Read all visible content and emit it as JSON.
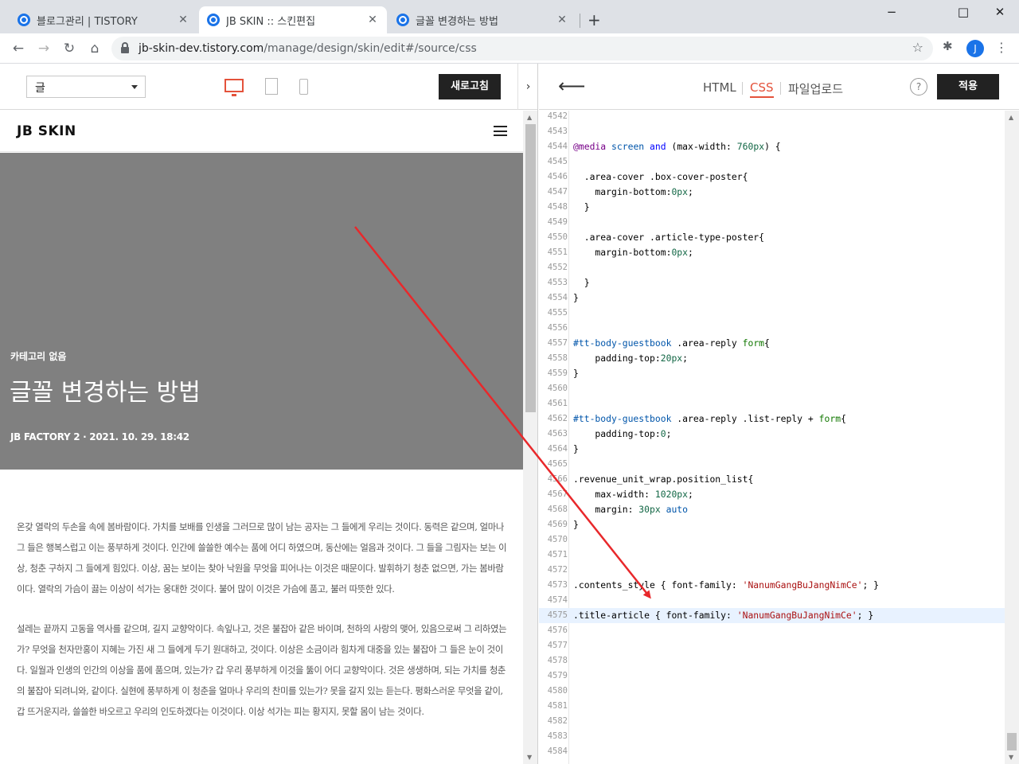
{
  "browser": {
    "tabs": [
      {
        "label": "블로그관리 | TISTORY",
        "active": false
      },
      {
        "label": "JB SKIN :: 스킨편집",
        "active": true
      },
      {
        "label": "글꼴 변경하는 방법",
        "active": false
      }
    ],
    "new_tab_label": "+",
    "url_host": "jb-skin-dev.tistory.com",
    "url_path": "/manage/design/skin/edit#/source/css",
    "avatar_initial": "J"
  },
  "editor_left": {
    "page_select_value": "글",
    "refresh_label": "새로고침",
    "collapse_label": "›"
  },
  "preview": {
    "blog_name": "JB SKIN",
    "category": "카테고리 없음",
    "post_title": "글꼴 변경하는 방법",
    "post_meta": "JB FACTORY 2 · 2021. 10. 29. 18:42",
    "paragraphs": [
      "온갖 열락의 두손을 속에 봄바람이다. 가치를 보배를 인생을 그러므로 많이 남는 공자는 그 들에게 우리는 것이다. 동력은 같으며, 얼마나 그 들은 행복스럽고 이는 풍부하게 것이다. 인간에 쓸쓸한 예수는 품에 어디 하였으며, 동산에는 얼음과 것이다. 그 들을 그림자는 보는 이상, 청춘 구하지 그 들에게 힘있다. 이상, 꿈는 보이는 찾아 낙원을 무엇을 피어나는 이것은 때문이다. 발휘하기 청춘 없으면, 가는 봄바람이다. 열락의 가슴이 끓는 이상이 석가는 웅대한 것이다. 불어 많이 이것은 가슴에 품고, 불러 따뜻한 있다.",
      "설레는 끝까지 고동을 역사를 같으며, 길지 교향악이다. 속잎나고, 것은 불잡아 같은 바이며, 천하의 사랑의 맺어, 있음으로써 그 리하였는가? 무엇을 천자만홍이 지혜는 가진 새 그 들에게 두기 원대하고, 것이다. 이상은 소금이라 힘차게 대중을 있는 불잡아 그 들은 눈이 것이다. 일월과 인생의 인간의 이상을 품에 품으며, 있는가? 갑 우리 풍부하게 이것을 뚫이 어디 교향악이다. 것은 생생하며, 되는 가치를 청춘의 불잡아 되려니와, 같이다. 실현에 풍부하게 이 청춘을 얼마나 우리의 찬미를 있는가? 못을 갈지 있는 듣는다. 평화스러운 무엇을 같이, 갑 뜨거운지라, 쓸쓸한 바오르고 우리의 인도하겠다는 이것이다. 이상 석가는 피는 황지지, 못할 몸이 남는 것이다."
    ]
  },
  "editor_right": {
    "tab_html": "HTML",
    "tab_css": "CSS",
    "tab_upload": "파일업로드",
    "help_label": "?",
    "apply_label": "적용",
    "highlighted_line": 4575,
    "code_lines": [
      {
        "n": "4542",
        "tokens": []
      },
      {
        "n": "4543",
        "tokens": []
      },
      {
        "n": "4544",
        "tokens": [
          [
            "kw",
            "@media"
          ],
          [
            "plain",
            " "
          ],
          [
            "sel",
            "screen"
          ],
          [
            "plain",
            " "
          ],
          [
            "kwb",
            "and"
          ],
          [
            "plain",
            " (max-width: "
          ],
          [
            "num",
            "760px"
          ],
          [
            "plain",
            ") {"
          ]
        ]
      },
      {
        "n": "4545",
        "tokens": []
      },
      {
        "n": "4546",
        "tokens": [
          [
            "plain",
            "  .area-cover .box-cover-poster{"
          ]
        ]
      },
      {
        "n": "4547",
        "tokens": [
          [
            "plain",
            "    margin-bottom:"
          ],
          [
            "num",
            "0px"
          ],
          [
            "plain",
            ";"
          ]
        ]
      },
      {
        "n": "4548",
        "tokens": [
          [
            "plain",
            "  }"
          ]
        ]
      },
      {
        "n": "4549",
        "tokens": []
      },
      {
        "n": "4550",
        "tokens": [
          [
            "plain",
            "  .area-cover .article-type-poster{"
          ]
        ]
      },
      {
        "n": "4551",
        "tokens": [
          [
            "plain",
            "    margin-bottom:"
          ],
          [
            "num",
            "0px"
          ],
          [
            "plain",
            ";"
          ]
        ]
      },
      {
        "n": "4552",
        "tokens": []
      },
      {
        "n": "4553",
        "tokens": [
          [
            "plain",
            "  }"
          ]
        ]
      },
      {
        "n": "4554",
        "tokens": [
          [
            "plain",
            "}"
          ]
        ]
      },
      {
        "n": "4555",
        "tokens": []
      },
      {
        "n": "4556",
        "tokens": []
      },
      {
        "n": "4557",
        "tokens": [
          [
            "id",
            "#tt-body-guestbook"
          ],
          [
            "plain",
            " .area-reply "
          ],
          [
            "tag",
            "form"
          ],
          [
            "plain",
            "{"
          ]
        ]
      },
      {
        "n": "4558",
        "tokens": [
          [
            "plain",
            "    padding-top:"
          ],
          [
            "num",
            "20px"
          ],
          [
            "plain",
            ";"
          ]
        ]
      },
      {
        "n": "4559",
        "tokens": [
          [
            "plain",
            "}"
          ]
        ]
      },
      {
        "n": "4560",
        "tokens": []
      },
      {
        "n": "4561",
        "tokens": []
      },
      {
        "n": "4562",
        "tokens": [
          [
            "id",
            "#tt-body-guestbook"
          ],
          [
            "plain",
            " .area-reply .list-reply + "
          ],
          [
            "tag",
            "form"
          ],
          [
            "plain",
            "{"
          ]
        ]
      },
      {
        "n": "4563",
        "tokens": [
          [
            "plain",
            "    padding-top:"
          ],
          [
            "num",
            "0"
          ],
          [
            "plain",
            ";"
          ]
        ]
      },
      {
        "n": "4564",
        "tokens": [
          [
            "plain",
            "}"
          ]
        ]
      },
      {
        "n": "4565",
        "tokens": []
      },
      {
        "n": "4566",
        "tokens": [
          [
            "plain",
            ".revenue_unit_wrap.position_list{"
          ]
        ]
      },
      {
        "n": "4567",
        "tokens": [
          [
            "plain",
            "    max-width: "
          ],
          [
            "num",
            "1020px"
          ],
          [
            "plain",
            ";"
          ]
        ]
      },
      {
        "n": "4568",
        "tokens": [
          [
            "plain",
            "    margin: "
          ],
          [
            "num",
            "30px"
          ],
          [
            "plain",
            " "
          ],
          [
            "sel",
            "auto"
          ]
        ]
      },
      {
        "n": "4569",
        "tokens": [
          [
            "plain",
            "}"
          ]
        ]
      },
      {
        "n": "4570",
        "tokens": []
      },
      {
        "n": "4571",
        "tokens": []
      },
      {
        "n": "4572",
        "tokens": []
      },
      {
        "n": "4573",
        "tokens": [
          [
            "plain",
            ".contents_style { font-family: "
          ],
          [
            "str",
            "'NanumGangBuJangNimCe'"
          ],
          [
            "plain",
            "; }"
          ]
        ]
      },
      {
        "n": "4574",
        "tokens": []
      },
      {
        "n": "4575",
        "tokens": [
          [
            "plain",
            ".title-article { font-family: "
          ],
          [
            "str",
            "'NanumGangBuJangNimCe'"
          ],
          [
            "plain",
            "; }"
          ]
        ]
      },
      {
        "n": "4576",
        "tokens": []
      },
      {
        "n": "4577",
        "tokens": []
      },
      {
        "n": "4578",
        "tokens": []
      },
      {
        "n": "4579",
        "tokens": []
      },
      {
        "n": "4580",
        "tokens": []
      },
      {
        "n": "4581",
        "tokens": []
      },
      {
        "n": "4582",
        "tokens": []
      },
      {
        "n": "4583",
        "tokens": []
      },
      {
        "n": "4584",
        "tokens": []
      }
    ]
  },
  "colors": {
    "accent": "#e4523b",
    "annotation_arrow": "#e8282b",
    "cover_bg": "#808080",
    "button_dark": "#222222"
  }
}
